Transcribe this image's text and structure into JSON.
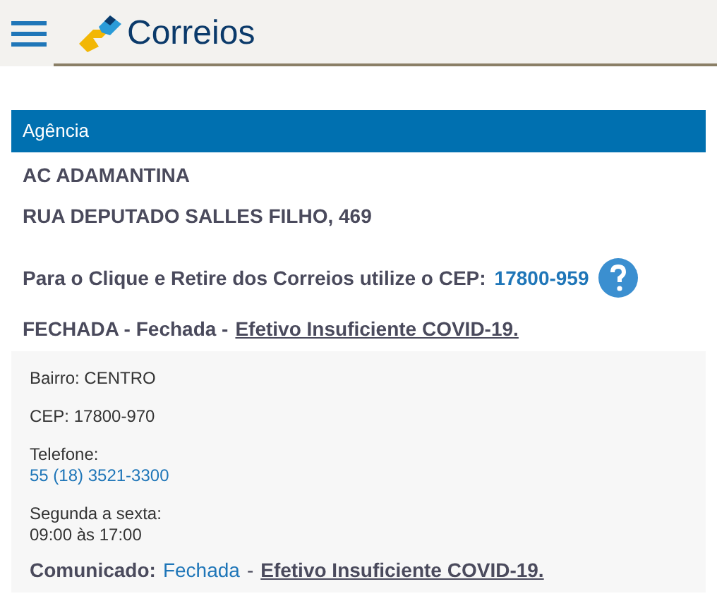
{
  "header": {
    "logo_text": "Correios"
  },
  "section": {
    "title": "Agência"
  },
  "agency": {
    "name": "AC ADAMANTINA",
    "address": "RUA DEPUTADO SALLES FILHO, 469",
    "pickup_text": "Para o Clique e Retire dos Correios utilize o CEP:",
    "pickup_cep": "17800-959",
    "status_text": "FECHADA - Fechada -",
    "status_link": "Efetivo Insuficiente COVID-19."
  },
  "details": [
    {
      "kind": "line",
      "text": "Bairro: CENTRO"
    },
    {
      "kind": "line",
      "text": "CEP: 17800-970"
    },
    {
      "kind": "phone",
      "label": "Telefone:",
      "value": "55 (18) 3521-3300"
    },
    {
      "kind": "hours",
      "label": "Segunda a sexta:",
      "value": "09:00 às 17:00"
    }
  ],
  "notice": {
    "label": "Comunicado:",
    "status": "Fechada",
    "separator": "-",
    "link": "Efetivo Insuficiente COVID-19."
  }
}
